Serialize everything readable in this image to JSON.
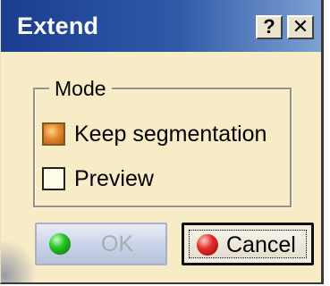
{
  "window": {
    "title": "Extend",
    "help_button_label": "?",
    "close_button_label": "✕"
  },
  "mode_group": {
    "legend": "Mode",
    "options": [
      {
        "label": "Keep segmentation",
        "checked": true
      },
      {
        "label": "Preview",
        "checked": false
      }
    ]
  },
  "buttons": {
    "ok_label": "OK",
    "ok_enabled": false,
    "cancel_label": "Cancel"
  },
  "colors": {
    "titlebar_start": "#1b3d8f",
    "titlebar_end": "#7fa1d1",
    "dialog_background": "#f7ecc6",
    "ok_icon": "green-ball",
    "cancel_icon": "red-ball"
  }
}
